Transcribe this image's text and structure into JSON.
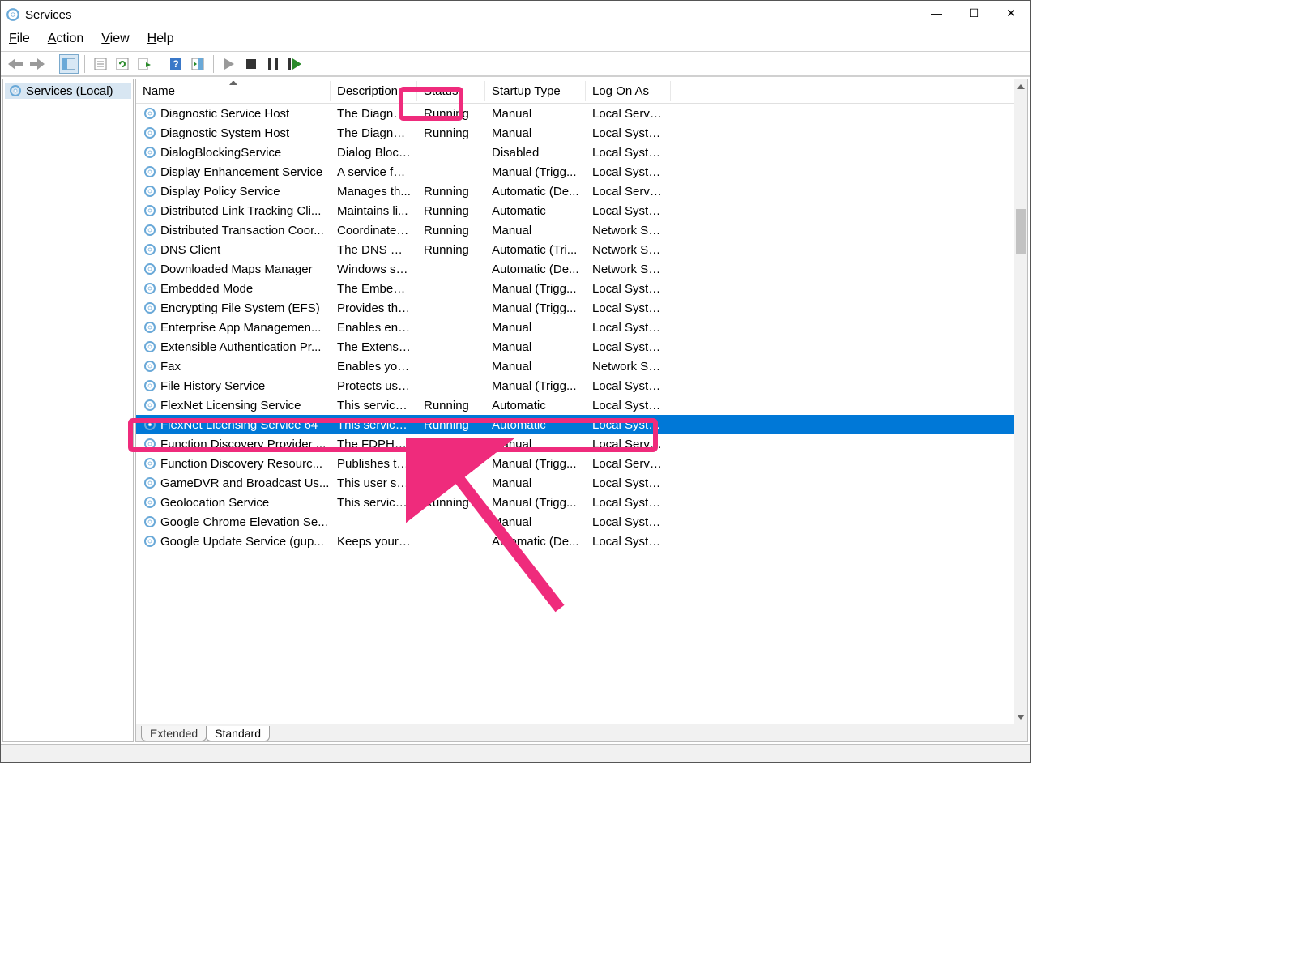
{
  "window": {
    "title": "Services",
    "controls": {
      "minimize": "—",
      "maximize": "☐",
      "close": "✕"
    }
  },
  "menu": {
    "file": "File",
    "action": "Action",
    "view": "View",
    "help": "Help"
  },
  "tree": {
    "root": "Services (Local)"
  },
  "columns": {
    "name": "Name",
    "description": "Description",
    "status": "Status",
    "startup": "Startup Type",
    "logon": "Log On As"
  },
  "tabs": {
    "extended": "Extended",
    "standard": "Standard"
  },
  "services": [
    {
      "name": "Diagnostic Service Host",
      "desc": "The Diagnos...",
      "status": "Running",
      "startup": "Manual",
      "logon": "Local Service"
    },
    {
      "name": "Diagnostic System Host",
      "desc": "The Diagnos...",
      "status": "Running",
      "startup": "Manual",
      "logon": "Local System"
    },
    {
      "name": "DialogBlockingService",
      "desc": "Dialog Block...",
      "status": "",
      "startup": "Disabled",
      "logon": "Local System"
    },
    {
      "name": "Display Enhancement Service",
      "desc": "A service for ...",
      "status": "",
      "startup": "Manual (Trigg...",
      "logon": "Local System"
    },
    {
      "name": "Display Policy Service",
      "desc": "Manages th...",
      "status": "Running",
      "startup": "Automatic (De...",
      "logon": "Local Service"
    },
    {
      "name": "Distributed Link Tracking Cli...",
      "desc": "Maintains li...",
      "status": "Running",
      "startup": "Automatic",
      "logon": "Local System"
    },
    {
      "name": "Distributed Transaction Coor...",
      "desc": "Coordinates ...",
      "status": "Running",
      "startup": "Manual",
      "logon": "Network Se..."
    },
    {
      "name": "DNS Client",
      "desc": "The DNS Cli...",
      "status": "Running",
      "startup": "Automatic (Tri...",
      "logon": "Network Se..."
    },
    {
      "name": "Downloaded Maps Manager",
      "desc": "Windows ser...",
      "status": "",
      "startup": "Automatic (De...",
      "logon": "Network Se..."
    },
    {
      "name": "Embedded Mode",
      "desc": "The Embedd...",
      "status": "",
      "startup": "Manual (Trigg...",
      "logon": "Local System"
    },
    {
      "name": "Encrypting File System (EFS)",
      "desc": "Provides the...",
      "status": "",
      "startup": "Manual (Trigg...",
      "logon": "Local System"
    },
    {
      "name": "Enterprise App Managemen...",
      "desc": "Enables ente...",
      "status": "",
      "startup": "Manual",
      "logon": "Local System"
    },
    {
      "name": "Extensible Authentication Pr...",
      "desc": "The Extensib...",
      "status": "",
      "startup": "Manual",
      "logon": "Local System"
    },
    {
      "name": "Fax",
      "desc": "Enables you ...",
      "status": "",
      "startup": "Manual",
      "logon": "Network Se..."
    },
    {
      "name": "File History Service",
      "desc": "Protects user...",
      "status": "",
      "startup": "Manual (Trigg...",
      "logon": "Local System"
    },
    {
      "name": "FlexNet Licensing Service",
      "desc": "This service ...",
      "status": "Running",
      "startup": "Automatic",
      "logon": "Local System"
    },
    {
      "name": "FlexNet Licensing Service 64",
      "desc": "This service ...",
      "status": "Running",
      "startup": "Automatic",
      "logon": "Local System",
      "selected": true
    },
    {
      "name": "Function Discovery Provider ...",
      "desc": "The FDPHOS...",
      "status": "",
      "startup": "Manual",
      "logon": "Local Service"
    },
    {
      "name": "Function Discovery Resourc...",
      "desc": "Publishes thi...",
      "status": "",
      "startup": "Manual (Trigg...",
      "logon": "Local Service"
    },
    {
      "name": "GameDVR and Broadcast Us...",
      "desc": "This user ser...",
      "status": "",
      "startup": "Manual",
      "logon": "Local System"
    },
    {
      "name": "Geolocation Service",
      "desc": "This service ...",
      "status": "Running",
      "startup": "Manual (Trigg...",
      "logon": "Local System"
    },
    {
      "name": "Google Chrome Elevation Se...",
      "desc": "",
      "status": "",
      "startup": "Manual",
      "logon": "Local System"
    },
    {
      "name": "Google Update Service (gup...",
      "desc": "Keeps your ...",
      "status": "",
      "startup": "Automatic (De...",
      "logon": "Local System"
    }
  ]
}
